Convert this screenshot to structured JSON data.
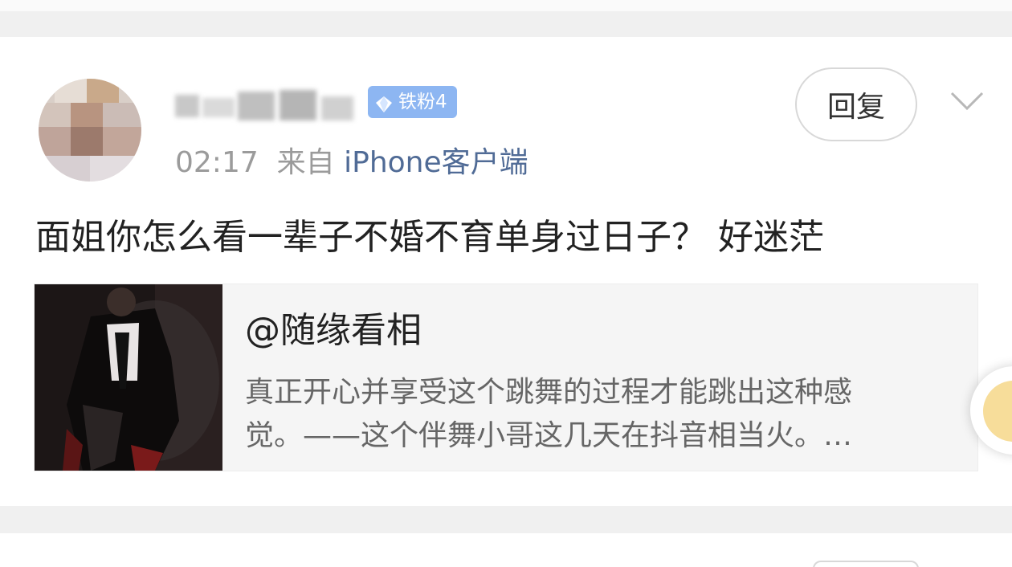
{
  "comment": {
    "badge_label": "铁粉4",
    "time": "02:17",
    "source_prefix": "来自",
    "source_client": "iPhone客户端",
    "reply_label": "回复",
    "text": "面姐你怎么看一辈子不婚不育单身过日子？ 好迷茫",
    "quoted_post": {
      "title": "@随缘看相",
      "body_line1": "真正开心并享受这个跳舞的过程才能跳出这种感",
      "body_line2": "觉。——这个伴舞小哥这几天在抖音相当火。…"
    }
  },
  "icons": {
    "badge": "diamond-icon",
    "more": "chevron-down-icon"
  },
  "colors": {
    "badge_bg": "#8db6f2",
    "client_link": "#506b96",
    "meta_gray": "#9b9b9b",
    "quote_bg": "#f5f5f5"
  }
}
